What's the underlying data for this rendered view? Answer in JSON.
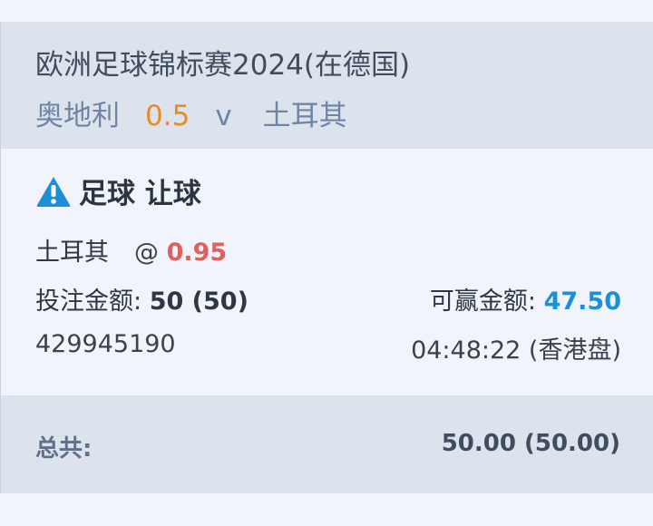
{
  "match": {
    "competition": "欧洲足球锦标赛2024(在德国)",
    "home_team": "奥地利",
    "handicap": "0.5",
    "vs": "v",
    "away_team": "土耳其"
  },
  "bet": {
    "warning_icon": "warning-triangle-icon",
    "type": "足球 让球",
    "selection": "土耳其",
    "at_symbol": "@",
    "odds": "0.95",
    "stake_label": "投注金额:",
    "stake_value": "50 (50)",
    "payout_label": "可赢金额:",
    "payout_value": "47.50",
    "ticket_id": "429945190",
    "time": "04:48:22 (香港盘)"
  },
  "total": {
    "label": "总共:",
    "value": "50.00 (50.00)"
  },
  "colors": {
    "handicap": "#ee8a24",
    "odds": "#e0605d",
    "payout": "#1f8ed8",
    "warning": "#1f8ed8",
    "header_bg": "#dde3ec",
    "card_bg": "#f1f4fb"
  }
}
